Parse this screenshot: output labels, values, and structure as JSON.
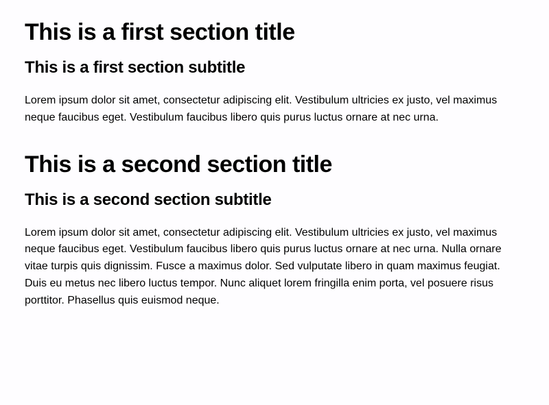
{
  "sections": [
    {
      "title": "This is a first section title",
      "subtitle": "This is a first section subtitle",
      "body": "Lorem ipsum dolor sit amet, consectetur adipiscing elit. Vestibulum ultricies ex justo, vel maximus neque faucibus eget. Vestibulum faucibus libero quis purus luctus ornare at nec urna."
    },
    {
      "title": "This is a second section title",
      "subtitle": "This is a second section subtitle",
      "body": "Lorem ipsum dolor sit amet, consectetur adipiscing elit. Vestibulum ultricies ex justo, vel maximus neque faucibus eget. Vestibulum faucibus libero quis purus luctus ornare at nec urna. Nulla ornare vitae turpis quis dignissim. Fusce a maximus dolor. Sed vulputate libero in quam maximus feugiat. Duis eu metus nec libero luctus tempor. Nunc aliquet lorem fringilla enim porta, vel posuere risus porttitor. Phasellus quis euismod neque."
    }
  ]
}
